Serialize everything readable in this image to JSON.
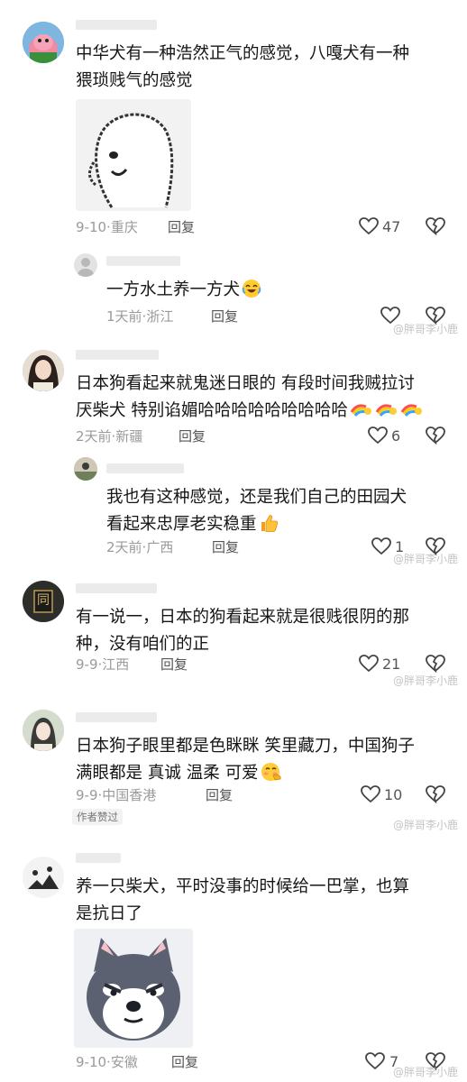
{
  "comments": [
    {
      "text_lines": [
        "中华犬有一种浩然正气的感觉，八嘎犬有一种",
        "猥琐贱气的感觉"
      ],
      "date": "9-10",
      "location": "重庆",
      "reply_label": "回复",
      "likes": "47",
      "reply": {
        "text": "一方水土养一方犬",
        "time": "1天前",
        "location": "浙江",
        "reply_label": "回复"
      }
    },
    {
      "text_lines": [
        "日本狗看起来就鬼迷日眼的 有段时间我贼拉讨",
        "厌柴犬 特别谄媚哈哈哈哈哈哈哈哈哈"
      ],
      "time": "2天前",
      "location": "新疆",
      "reply_label": "回复",
      "likes": "6",
      "reply": {
        "text_lines": [
          "我也有这种感觉，还是我们自己的田园犬",
          "看起来忠厚老实稳重"
        ],
        "time": "2天前",
        "location": "广西",
        "reply_label": "回复",
        "likes": "1"
      }
    },
    {
      "text_lines": [
        "有一说一，日本的狗看起来就是很贱很阴的那",
        "种，没有咱们的正"
      ],
      "date": "9-9",
      "location": "江西",
      "reply_label": "回复",
      "likes": "21"
    },
    {
      "text_lines": [
        "日本狗子眼里都是色眯眯 笑里藏刀，中国狗子",
        "满眼都是 真诚 温柔 可爱"
      ],
      "date": "9-9",
      "location": "中国香港",
      "reply_label": "回复",
      "likes": "10",
      "badge": "作者赞过"
    },
    {
      "text_lines": [
        "养一只柴犬，平时没事的时候给一巴掌，也算",
        "是抗日了"
      ],
      "date": "9-10",
      "location": "安徽",
      "reply_label": "回复",
      "likes": "7"
    }
  ],
  "avatar_glyphs": {
    "c3": "同"
  },
  "separator": "·",
  "watermark": "@胖哥李小鹿",
  "colors": {
    "text": "#161616",
    "meta": "#9a9a9a",
    "name_bar": "#ebebeb",
    "watermark": "#c4c4c4"
  },
  "icons": [
    "heart-icon",
    "broken-heart-icon",
    "laughing-crying-emoji",
    "thumbs-up-emoji",
    "rainbow-emoji",
    "shy-emoji"
  ]
}
